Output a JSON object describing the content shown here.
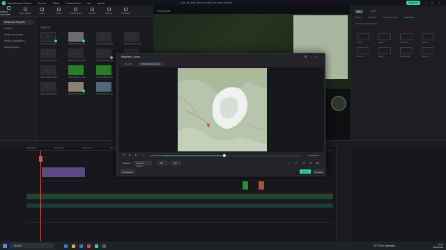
{
  "app": {
    "title": "Wondershare Filmora",
    "menu": [
      "Archivo",
      "Editar",
      "Herramientas",
      "Ver",
      "Ayuda"
    ],
    "document_title": "mio_ok_final_anuncio_gato_no_mola_version",
    "export_label": "Exportar"
  },
  "media_toolbar": {
    "tabs": [
      {
        "label": "Archivos multimedia"
      },
      {
        "label": "Stock Media"
      },
      {
        "label": "Audio"
      },
      {
        "label": "Títulos"
      },
      {
        "label": "Transiciones"
      },
      {
        "label": "Efectos"
      },
      {
        "label": "Stickers"
      },
      {
        "label": "Plantillas"
      }
    ]
  },
  "sidebar": {
    "items": [
      {
        "label": "Medios del Proyecto"
      },
      {
        "label": "Carpeta"
      },
      {
        "label": "Medios de la nube"
      },
      {
        "label": "Medios compartidos"
      },
      {
        "label": "Carpeta global"
      }
    ]
  },
  "media": {
    "header": "CARPETA",
    "items": [
      {
        "label": "Importar contenido"
      },
      {
        "label": "IMG_20231018_123000"
      },
      {
        "label": "IMG_20231018_125600"
      },
      {
        "label": "IMG_20231019_103000"
      },
      {
        "label": "IMG_20231019_104200"
      },
      {
        "label": "IMG_20231020_100000"
      },
      {
        "label": "IMG_20231020_101500"
      },
      {
        "label": "IMG_20231021_090000"
      },
      {
        "label": "IMG_20231021_093000"
      },
      {
        "label": "IMG_20231021_100000"
      },
      {
        "label": "IMG_20231022_110000"
      },
      {
        "label": "IMG_20231022_113000"
      },
      {
        "label": "IMG_20231023_090000"
      },
      {
        "label": "IMG_20231023_093000"
      },
      {
        "label": "IMG_20231023_100000"
      }
    ]
  },
  "preview": {
    "title": "Reproductor"
  },
  "right_panel": {
    "tabs": [
      "Imagen",
      "Color"
    ],
    "subtabs": [
      "Básico",
      "Máscara",
      "Inteligencia de IA",
      "Animación"
    ],
    "section": "Ajustes preestablecidos",
    "tiles": [
      "Arriba",
      "Abajo",
      "Izquierda",
      "Derecha",
      "Acercar",
      "Alejar",
      "Personalizar",
      "Ninguno"
    ]
  },
  "timeline": {
    "ruler": [
      "00:00:00:00",
      "00:00:05:00",
      "00:00:10:00",
      "00:00:15:00",
      "00:00:20:00",
      "00:00:25:00",
      "00:00:30:00",
      "00:00:35:00",
      "00:00:40:00",
      "00:00:45:00",
      "00:00:50:00"
    ]
  },
  "dialog": {
    "title": "Recortar y Zoom",
    "tabs": [
      "Recortar",
      "Panorámica y zoom"
    ],
    "time_current": "00:00:03:21",
    "time_total": "00:00:05:00",
    "progress": 0.45,
    "ratio_label": "Relación:",
    "ratio_value": "Relación original",
    "width": "480",
    "height": "480",
    "reset_label": "Restablecer",
    "apply_label": "Aplicar",
    "cancel_label": "Cancelar"
  },
  "taskbar": {
    "search_placeholder": "Buscar",
    "weather": "15°C Prac. despejado",
    "time": "12:14",
    "date": "12/04/2024"
  }
}
